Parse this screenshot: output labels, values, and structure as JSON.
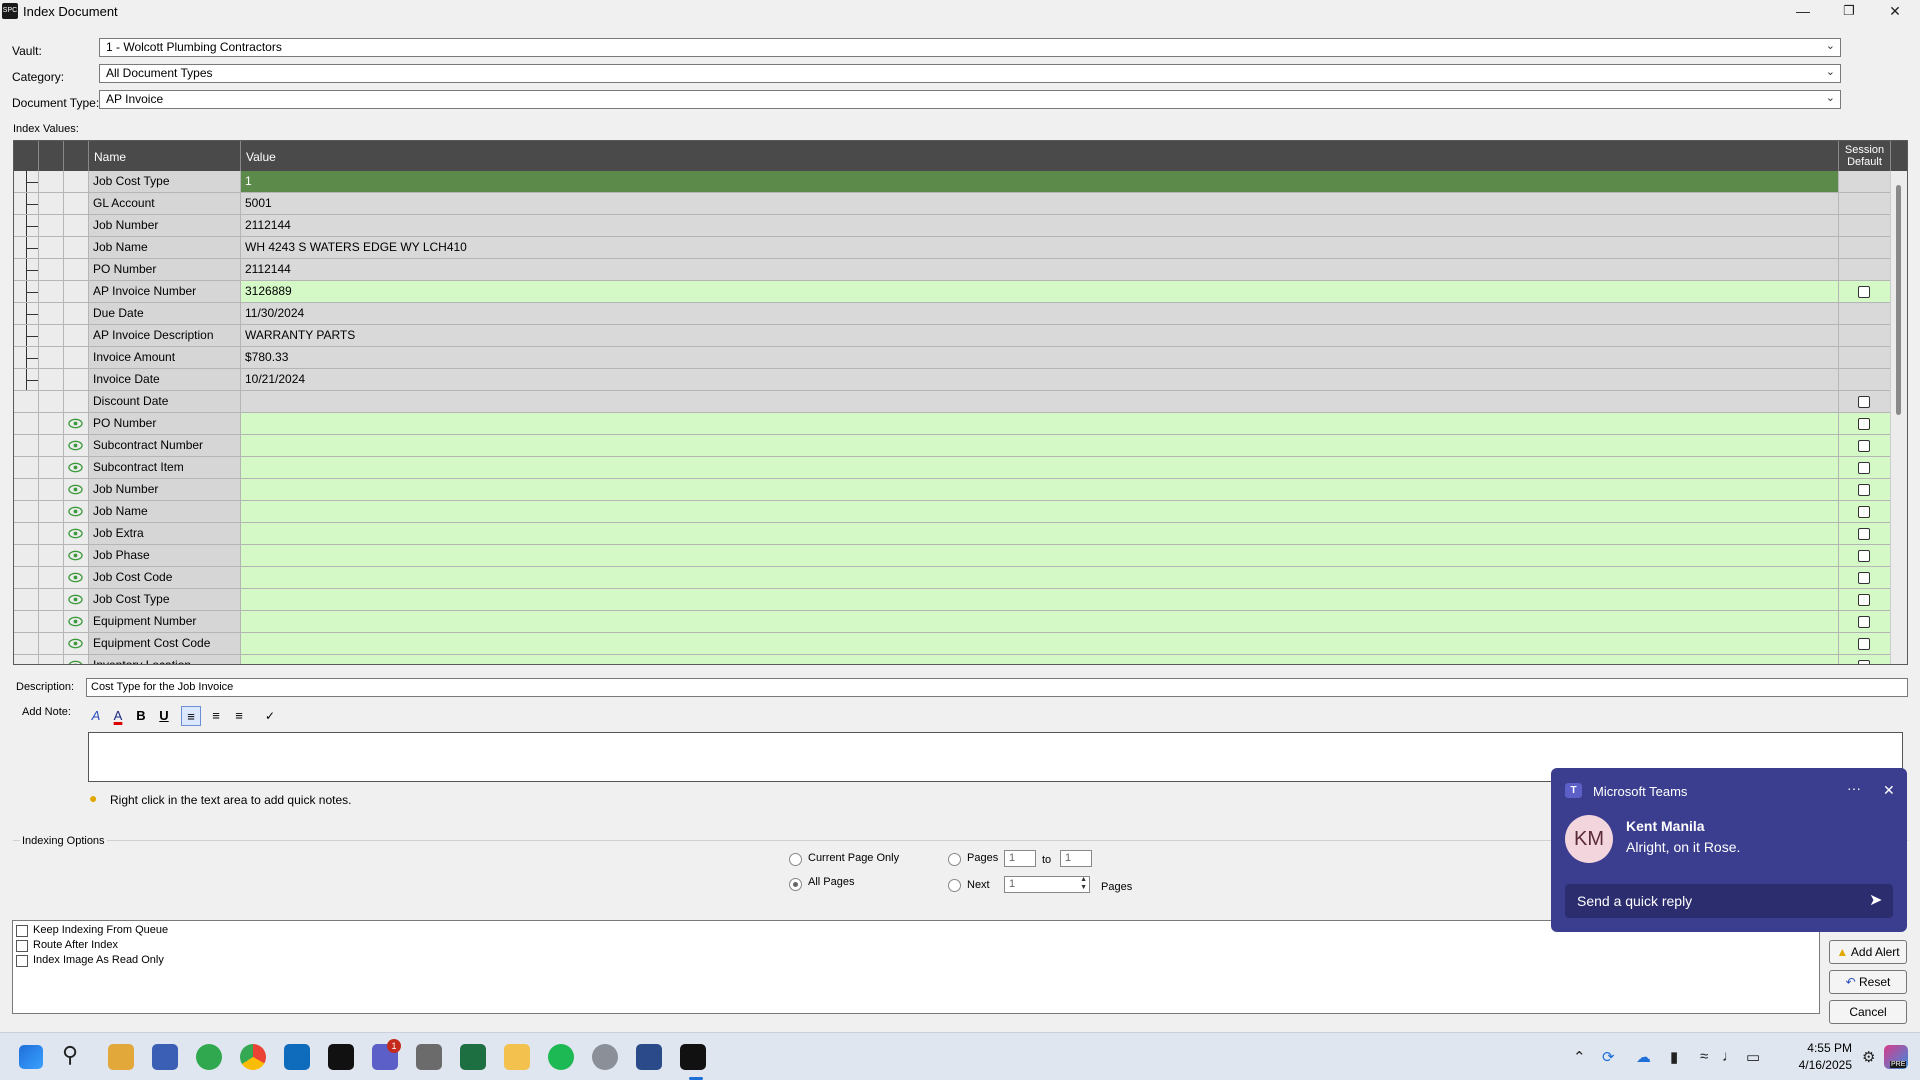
{
  "window": {
    "title": "Index Document",
    "app_icon_text": "SPC",
    "minimize": "—",
    "restore": "❐",
    "close": "✕"
  },
  "form": {
    "vault_label": "Vault:",
    "vault_value": "1 - Wolcott Plumbing Contractors",
    "category_label": "Category:",
    "category_value": "All Document Types",
    "doctype_label": "Document Type:",
    "doctype_value": "AP Invoice",
    "index_values_label": "Index Values:"
  },
  "grid": {
    "headers": {
      "name": "Name",
      "value": "Value",
      "session_default": "Session Default"
    },
    "rows": [
      {
        "name": "Job Cost Type",
        "value": "1",
        "style": "dark",
        "checkbox": false,
        "eye": false,
        "tree": true
      },
      {
        "name": "GL Account",
        "value": "5001",
        "style": "grey",
        "checkbox": false,
        "eye": false,
        "tree": true
      },
      {
        "name": "Job Number",
        "value": "2112144",
        "style": "grey",
        "checkbox": false,
        "eye": false,
        "tree": true
      },
      {
        "name": "Job Name",
        "value": "WH 4243 S WATERS EDGE WY LCH410",
        "style": "grey",
        "checkbox": false,
        "eye": false,
        "tree": true
      },
      {
        "name": "PO Number",
        "value": "2112144",
        "style": "grey",
        "checkbox": false,
        "eye": false,
        "tree": true
      },
      {
        "name": "AP Invoice Number",
        "value": "3126889",
        "style": "green",
        "checkbox": true,
        "eye": false,
        "tree": true
      },
      {
        "name": "Due Date",
        "value": "11/30/2024",
        "style": "grey",
        "checkbox": false,
        "eye": false,
        "tree": true
      },
      {
        "name": "AP Invoice Description",
        "value": "WARRANTY PARTS",
        "style": "grey",
        "checkbox": false,
        "eye": false,
        "tree": true
      },
      {
        "name": "Invoice Amount",
        "value": "$780.33",
        "style": "grey",
        "checkbox": false,
        "eye": false,
        "tree": true
      },
      {
        "name": "Invoice Date",
        "value": "10/21/2024",
        "style": "grey",
        "checkbox": false,
        "eye": false,
        "tree": true
      },
      {
        "name": "Discount Date",
        "value": "",
        "style": "grey",
        "checkbox": true,
        "eye": false,
        "tree": false
      },
      {
        "name": "PO Number",
        "value": "",
        "style": "green",
        "checkbox": true,
        "eye": true,
        "tree": false
      },
      {
        "name": "Subcontract Number",
        "value": "",
        "style": "green",
        "checkbox": true,
        "eye": true,
        "tree": false
      },
      {
        "name": "Subcontract Item",
        "value": "",
        "style": "green",
        "checkbox": true,
        "eye": true,
        "tree": false
      },
      {
        "name": "Job Number",
        "value": "",
        "style": "green",
        "checkbox": true,
        "eye": true,
        "tree": false
      },
      {
        "name": "Job Name",
        "value": "",
        "style": "green",
        "checkbox": true,
        "eye": true,
        "tree": false
      },
      {
        "name": "Job Extra",
        "value": "",
        "style": "green",
        "checkbox": true,
        "eye": true,
        "tree": false
      },
      {
        "name": "Job Phase",
        "value": "",
        "style": "green",
        "checkbox": true,
        "eye": true,
        "tree": false
      },
      {
        "name": "Job Cost Code",
        "value": "",
        "style": "green",
        "checkbox": true,
        "eye": true,
        "tree": false
      },
      {
        "name": "Job Cost Type",
        "value": "",
        "style": "green",
        "checkbox": true,
        "eye": true,
        "tree": false
      },
      {
        "name": "Equipment Number",
        "value": "",
        "style": "green",
        "checkbox": true,
        "eye": true,
        "tree": false
      },
      {
        "name": "Equipment Cost Code",
        "value": "",
        "style": "green",
        "checkbox": true,
        "eye": true,
        "tree": false
      },
      {
        "name": "Inventory Location",
        "value": "",
        "style": "green",
        "checkbox": true,
        "eye": true,
        "tree": false
      }
    ]
  },
  "description": {
    "label": "Description:",
    "value": "Cost Type for the Job Invoice"
  },
  "note": {
    "label": "Add Note:",
    "tip": "Right click in the text area to add quick notes."
  },
  "toolbar": {
    "bold": "B",
    "underline": "U"
  },
  "indexing_options": {
    "label": "Indexing Options",
    "current_page_only": "Current Page Only",
    "all_pages": "All Pages",
    "pages": "Pages",
    "pages_from": "1",
    "to": "to",
    "pages_to": "1",
    "next": "Next",
    "next_value": "1",
    "pages_suffix": "Pages"
  },
  "checks": {
    "keep_indexing": "Keep Indexing From Queue",
    "route_after": "Route After Index",
    "read_only": "Index Image As Read Only"
  },
  "buttons": {
    "add_alert": "Add Alert",
    "reset": "Reset",
    "cancel": "Cancel"
  },
  "teams": {
    "app": "Microsoft Teams",
    "initials": "KM",
    "sender": "Kent Manila",
    "message": "Alright, on it Rose.",
    "reply_placeholder": "Send a quick reply",
    "more": "···",
    "close": "✕"
  },
  "taskbar": {
    "time": "4:55 PM",
    "date": "4/16/2025",
    "badge": "1",
    "tray_badge": "PRE"
  }
}
